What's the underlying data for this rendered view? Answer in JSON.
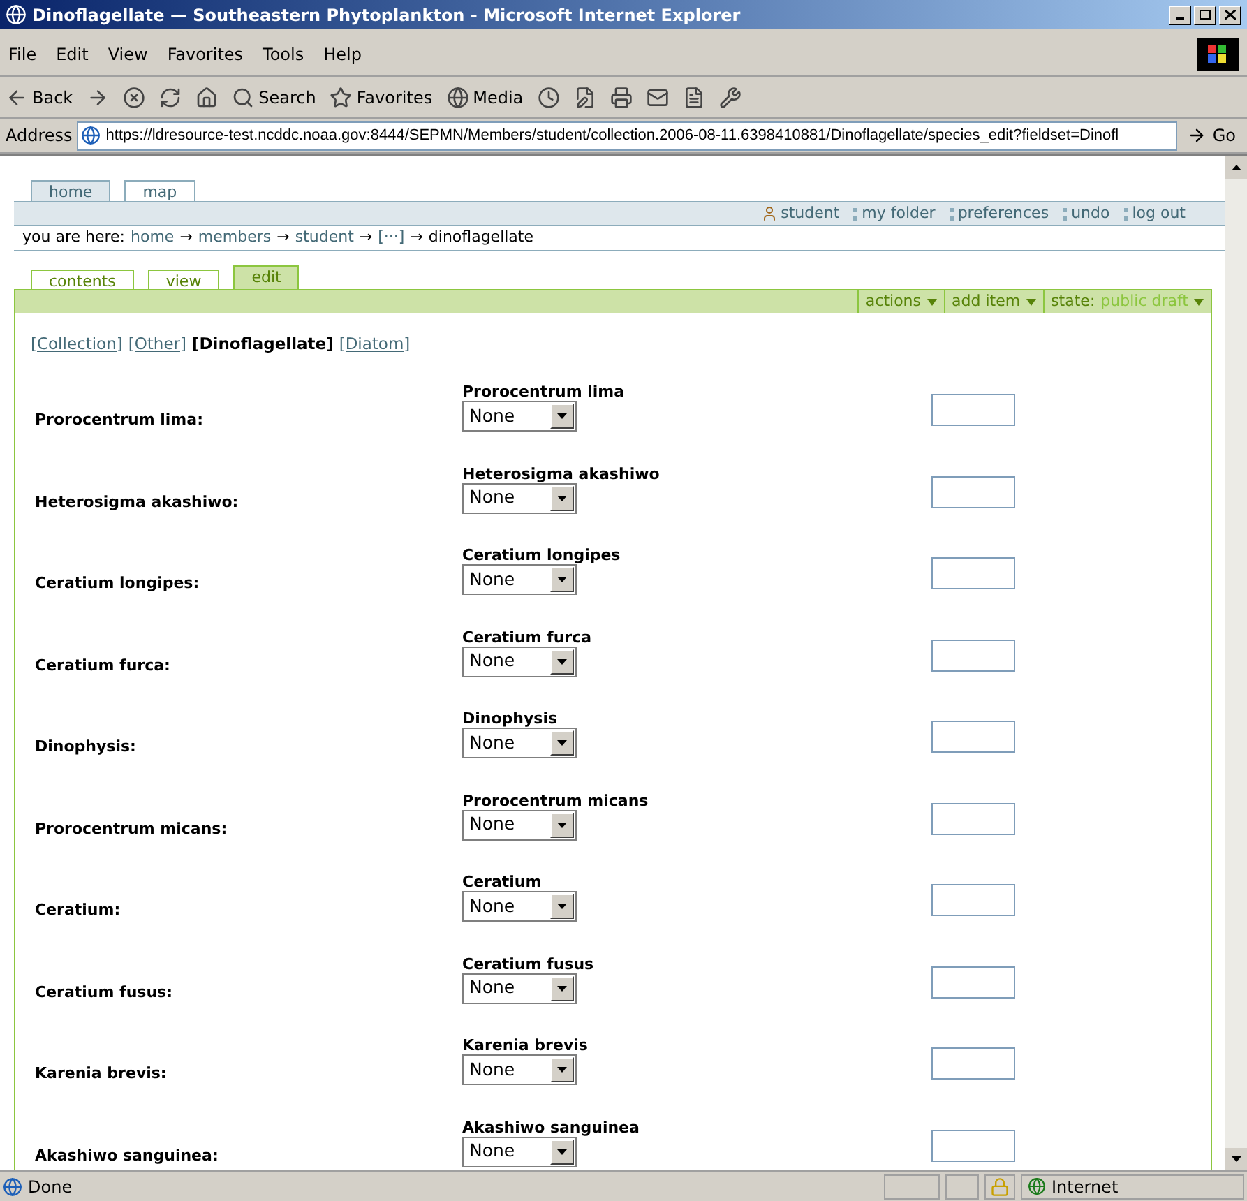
{
  "window": {
    "title": "Dinoflagellate — Southeastern Phytoplankton - Microsoft Internet Explorer"
  },
  "menu": [
    {
      "label": "File"
    },
    {
      "label": "Edit"
    },
    {
      "label": "View"
    },
    {
      "label": "Favorites"
    },
    {
      "label": "Tools"
    },
    {
      "label": "Help"
    }
  ],
  "toolbar": [
    {
      "kind": "back",
      "label": "Back"
    },
    {
      "kind": "forward"
    },
    {
      "kind": "stop"
    },
    {
      "kind": "refresh"
    },
    {
      "kind": "home"
    },
    {
      "kind": "search",
      "label": "Search"
    },
    {
      "kind": "favorites",
      "label": "Favorites"
    },
    {
      "kind": "media",
      "label": "Media"
    },
    {
      "kind": "history"
    },
    {
      "kind": "edit"
    },
    {
      "kind": "print"
    },
    {
      "kind": "mail"
    },
    {
      "kind": "page"
    },
    {
      "kind": "tool"
    }
  ],
  "address": {
    "label": "Address",
    "value": "https://ldresource-test.ncddc.noaa.gov:8444/SEPMN/Members/student/collection.2006-08-11.6398410881/Dinoflagellate/species_edit?fieldset=Dinofl",
    "go": "Go"
  },
  "portal_tabs": [
    {
      "label": "home",
      "selected": true
    },
    {
      "label": "map",
      "selected": false
    }
  ],
  "personal_bar": [
    {
      "kind": "user",
      "label": "student"
    },
    {
      "kind": "link",
      "label": "my folder"
    },
    {
      "kind": "link",
      "label": "preferences"
    },
    {
      "kind": "link",
      "label": "undo"
    },
    {
      "kind": "link",
      "label": "log out"
    }
  ],
  "breadcrumb": {
    "prefix": "you are here:",
    "links": [
      "home",
      "members",
      "student",
      "[···]"
    ],
    "current": "dinoflagellate",
    "separator": "→"
  },
  "content_tabs": [
    {
      "label": "contents",
      "selected": false
    },
    {
      "label": "view",
      "selected": false
    },
    {
      "label": "edit",
      "selected": true
    }
  ],
  "action_menus": [
    {
      "label": "actions"
    },
    {
      "label": "add item"
    },
    {
      "label": "state:",
      "value": "public draft"
    }
  ],
  "fieldsets": [
    {
      "label": "[Collection]",
      "selected": false
    },
    {
      "label": "[Other]",
      "selected": false
    },
    {
      "label": "[Dinoflagellate]",
      "selected": true
    },
    {
      "label": "[Diatom]",
      "selected": false
    }
  ],
  "rows": [
    {
      "label": "Prorocentrum lima:",
      "heading": "Prorocentrum lima",
      "select": "None"
    },
    {
      "label": "Heterosigma akashiwo:",
      "heading": "Heterosigma akashiwo",
      "select": "None"
    },
    {
      "label": "Ceratium longipes:",
      "heading": "Ceratium longipes",
      "select": "None"
    },
    {
      "label": "Ceratium furca:",
      "heading": "Ceratium furca",
      "select": "None"
    },
    {
      "label": "Dinophysis:",
      "heading": "Dinophysis",
      "select": "None"
    },
    {
      "label": "Prorocentrum micans:",
      "heading": "Prorocentrum micans",
      "select": "None"
    },
    {
      "label": "Ceratium:",
      "heading": "Ceratium",
      "select": "None"
    },
    {
      "label": "Ceratium fusus:",
      "heading": "Ceratium fusus",
      "select": "None"
    },
    {
      "label": "Karenia brevis:",
      "heading": "Karenia brevis",
      "select": "None"
    },
    {
      "label": "Akashiwo sanguinea:",
      "heading": "Akashiwo sanguinea",
      "select": "None"
    }
  ],
  "status_bar": {
    "text": "Done",
    "zone": "Internet",
    "secure": true
  }
}
